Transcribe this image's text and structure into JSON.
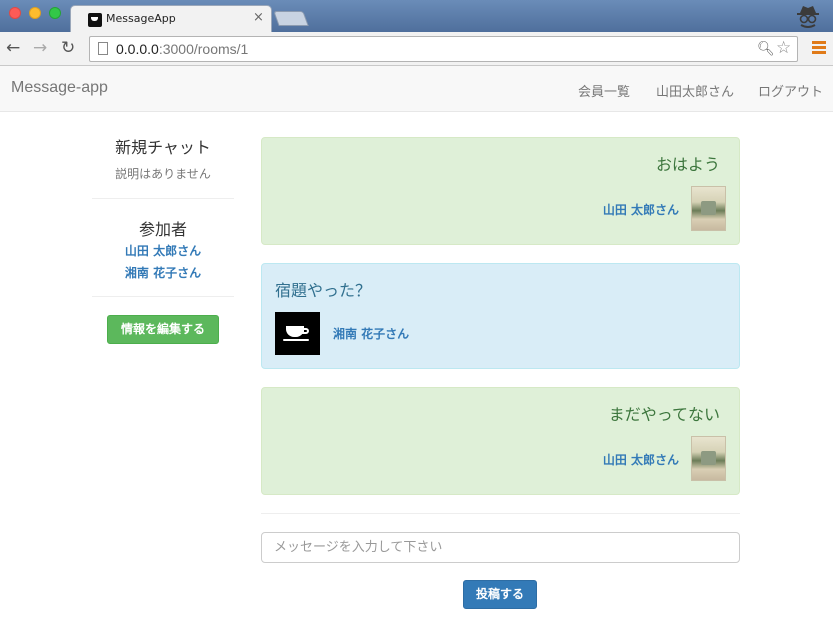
{
  "browser": {
    "tab_title": "MessageApp",
    "tab_close": "×",
    "url_host": "0.0.0.0",
    "url_rest": ":3000/rooms/1"
  },
  "navbar": {
    "brand": "Message-app",
    "links": [
      "会員一覧",
      "山田太郎さん",
      "ログアウト"
    ]
  },
  "sidebar": {
    "room_title": "新規チャット",
    "room_description": "説明はありません",
    "members_title": "参加者",
    "members": [
      "山田 太郎さん",
      "湘南 花子さん"
    ],
    "edit_button": "情報を編集する"
  },
  "messages": [
    {
      "text": "おはよう",
      "author": "山田 太郎さん",
      "style": "mine",
      "color": "#dff0d8"
    },
    {
      "text": "宿題やった？",
      "author": "湘南 花子さん",
      "style": "other",
      "color": "#d9edf7"
    },
    {
      "text": "まだやってない",
      "author": "山田 太郎さん",
      "style": "mine",
      "color": "#dff0d8"
    }
  ],
  "composer": {
    "placeholder": "メッセージを入力して下さい",
    "value": "",
    "submit_label": "投稿する"
  },
  "colors": {
    "primary": "#337ab7",
    "success": "#5cb85c"
  }
}
